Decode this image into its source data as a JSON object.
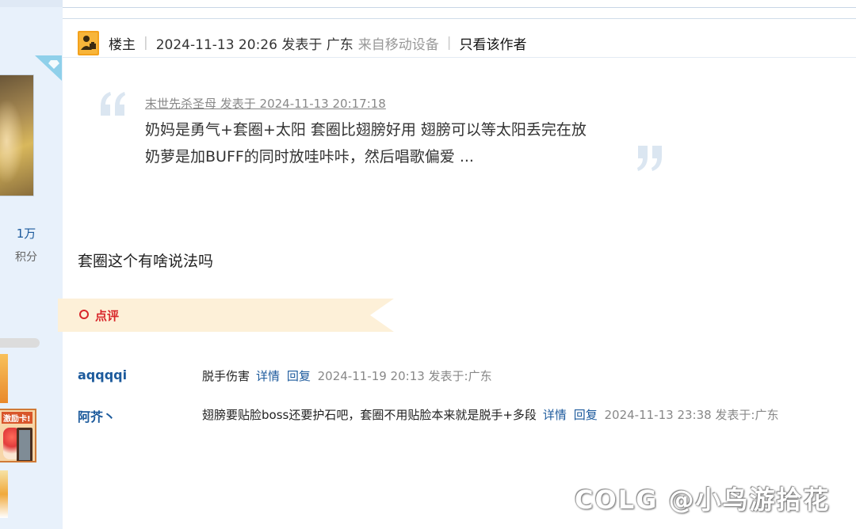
{
  "sidebar": {
    "stat_value": "1万",
    "stat_label": "积分",
    "card_badge_text": "激励卡!"
  },
  "post_header": {
    "role": "楼主",
    "time_text": "2024-11-13 20:26 发表于 广东",
    "source": "来自移动设备",
    "only_author": "只看该作者"
  },
  "quote": {
    "author_line": "末世先杀圣母 发表于 2024-11-13 20:17:18",
    "line1": "奶妈是勇气+套圈+太阳 套圈比翅膀好用 翅膀可以等太阳丢完在放",
    "line2": "奶萝是加BUFF的同时放哇咔咔，然后唱歌偏爱 ..."
  },
  "post_body": "套圈这个有啥说法吗",
  "comment_section": {
    "label": "点评"
  },
  "comments": [
    {
      "user": "aqqqqi",
      "text": "脱手伤害",
      "detail": "详情",
      "reply": "回复",
      "timestamp": "2024-11-19 20:13 发表于:广东"
    },
    {
      "user": "阿芥丶",
      "text": "翅膀要贴脸boss还要护石吧，套圈不用贴脸本来就是脱手+多段",
      "detail": "详情",
      "reply": "回复",
      "timestamp": "2024-11-13 23:38 发表于:广东"
    }
  ],
  "watermark": "COLG @小鸟游拾花",
  "colors": {
    "link": "#1c5a9c",
    "accent_red": "#d8262a",
    "banner": "#fdf0d8",
    "sidebar": "#e8f1fb"
  }
}
